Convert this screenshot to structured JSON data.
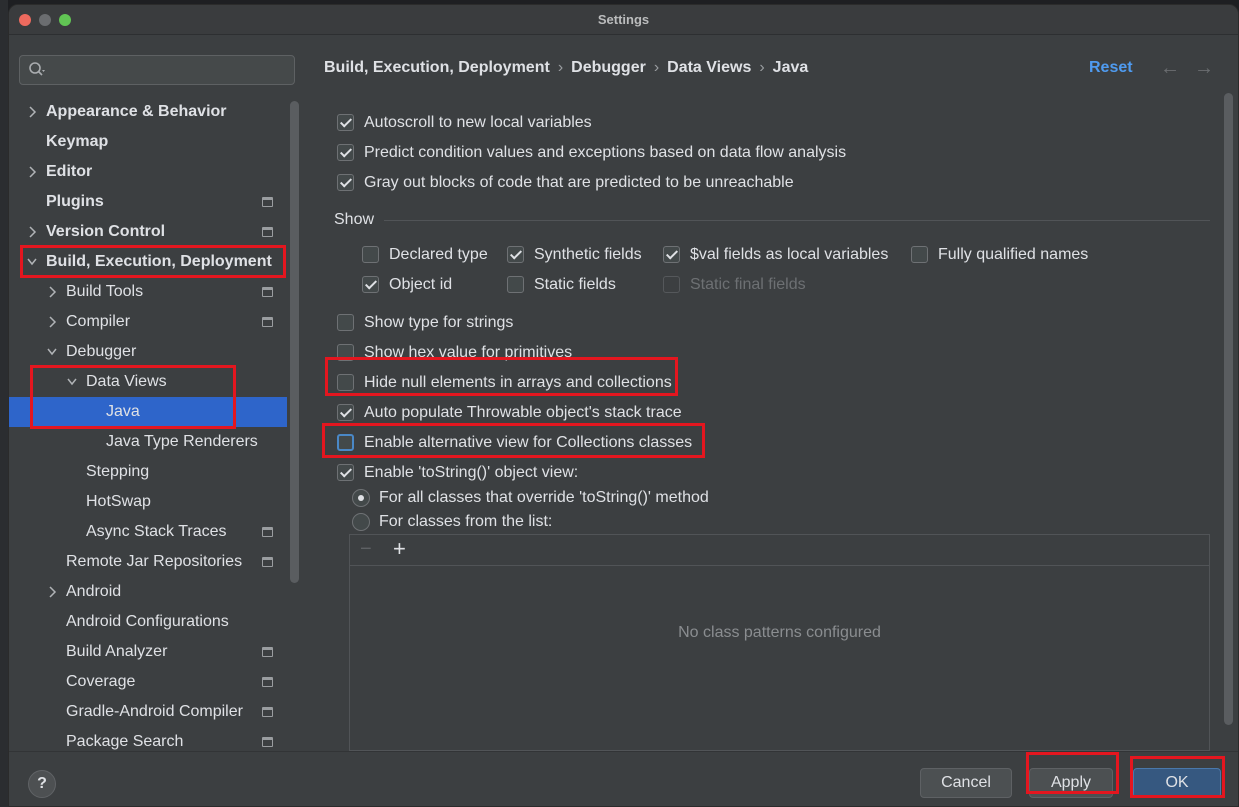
{
  "window": {
    "title": "Settings"
  },
  "search": {
    "placeholder": ""
  },
  "sidebar": {
    "items": [
      {
        "label": "Appearance & Behavior",
        "bold": true,
        "expandable": true,
        "expanded": false,
        "indent": 0,
        "project_icon": false
      },
      {
        "label": "Keymap",
        "bold": true,
        "expandable": false,
        "indent": 0,
        "project_icon": false
      },
      {
        "label": "Editor",
        "bold": true,
        "expandable": true,
        "expanded": false,
        "indent": 0,
        "project_icon": false
      },
      {
        "label": "Plugins",
        "bold": true,
        "expandable": false,
        "indent": 0,
        "project_icon": true
      },
      {
        "label": "Version Control",
        "bold": true,
        "expandable": true,
        "expanded": false,
        "indent": 0,
        "project_icon": true
      },
      {
        "label": "Build, Execution, Deployment",
        "bold": true,
        "expandable": true,
        "expanded": true,
        "indent": 0,
        "project_icon": false
      },
      {
        "label": "Build Tools",
        "bold": false,
        "expandable": true,
        "expanded": false,
        "indent": 1,
        "project_icon": true
      },
      {
        "label": "Compiler",
        "bold": false,
        "expandable": true,
        "expanded": false,
        "indent": 1,
        "project_icon": true
      },
      {
        "label": "Debugger",
        "bold": false,
        "expandable": true,
        "expanded": true,
        "indent": 1,
        "project_icon": false
      },
      {
        "label": "Data Views",
        "bold": false,
        "expandable": true,
        "expanded": true,
        "indent": 2,
        "project_icon": false
      },
      {
        "label": "Java",
        "bold": false,
        "expandable": false,
        "indent": 3,
        "project_icon": false,
        "selected": true
      },
      {
        "label": "Java Type Renderers",
        "bold": false,
        "expandable": false,
        "indent": 3,
        "project_icon": false
      },
      {
        "label": "Stepping",
        "bold": false,
        "expandable": false,
        "indent": 2,
        "project_icon": false
      },
      {
        "label": "HotSwap",
        "bold": false,
        "expandable": false,
        "indent": 2,
        "project_icon": false
      },
      {
        "label": "Async Stack Traces",
        "bold": false,
        "expandable": false,
        "indent": 2,
        "project_icon": true
      },
      {
        "label": "Remote Jar Repositories",
        "bold": false,
        "expandable": false,
        "indent": 1,
        "project_icon": true
      },
      {
        "label": "Android",
        "bold": false,
        "expandable": true,
        "expanded": false,
        "indent": 1,
        "project_icon": false
      },
      {
        "label": "Android Configurations",
        "bold": false,
        "expandable": false,
        "indent": 1,
        "project_icon": false
      },
      {
        "label": "Build Analyzer",
        "bold": false,
        "expandable": false,
        "indent": 1,
        "project_icon": true
      },
      {
        "label": "Coverage",
        "bold": false,
        "expandable": false,
        "indent": 1,
        "project_icon": true
      },
      {
        "label": "Gradle-Android Compiler",
        "bold": false,
        "expandable": false,
        "indent": 1,
        "project_icon": true
      },
      {
        "label": "Package Search",
        "bold": false,
        "expandable": false,
        "indent": 1,
        "project_icon": true
      }
    ]
  },
  "breadcrumb": [
    "Build, Execution, Deployment",
    "Debugger",
    "Data Views",
    "Java"
  ],
  "header": {
    "reset_label": "Reset",
    "back_arrow": "←",
    "forward_arrow": "→"
  },
  "options_top": [
    {
      "label": "Autoscroll to new local variables",
      "checked": true
    },
    {
      "label": "Predict condition values and exceptions based on data flow analysis",
      "checked": true
    },
    {
      "label": "Gray out blocks of code that are predicted to be unreachable",
      "checked": true
    }
  ],
  "show_section": {
    "title": "Show",
    "row1": [
      {
        "label": "Declared type",
        "checked": false
      },
      {
        "label": "Synthetic fields",
        "checked": true
      },
      {
        "label": "$val fields as local variables",
        "checked": true
      },
      {
        "label": "Fully qualified names",
        "checked": false
      }
    ],
    "row2": [
      {
        "label": "Object id",
        "checked": true
      },
      {
        "label": "Static fields",
        "checked": false
      },
      {
        "label": "Static final fields",
        "checked": false,
        "disabled": true
      }
    ]
  },
  "options_bottom": [
    {
      "label": "Show type for strings",
      "checked": false
    },
    {
      "label": "Show hex value for primitives",
      "checked": false
    },
    {
      "label": "Hide null elements in arrays and collections",
      "checked": false
    },
    {
      "label": "Auto populate Throwable object's stack trace",
      "checked": true
    },
    {
      "label": "Enable alternative view for Collections classes",
      "checked": false,
      "focused": true
    },
    {
      "label": "Enable 'toString()' object view:",
      "checked": true
    }
  ],
  "tostring_radios": [
    {
      "label": "For all classes that override 'toString()' method",
      "checked": true
    },
    {
      "label": "For classes from the list:",
      "checked": false
    }
  ],
  "class_list": {
    "remove_glyph": "−",
    "add_glyph": "+",
    "empty_text": "No class patterns configured"
  },
  "footer": {
    "help_label": "?",
    "cancel_label": "Cancel",
    "apply_label": "Apply",
    "ok_label": "OK"
  },
  "colors": {
    "selection": "#2e65ca",
    "accent": "#4f9bf0",
    "highlight_box": "#e4161f",
    "primary_button": "#365880"
  }
}
